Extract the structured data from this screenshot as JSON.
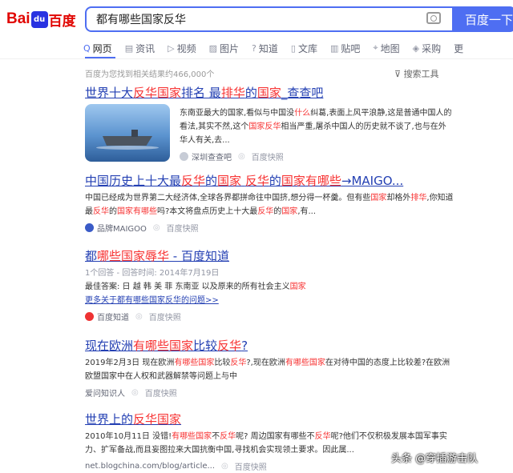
{
  "header": {
    "logo_text": "Bai",
    "logo_du": "du",
    "logo_zh": "百度",
    "search_value": "都有哪些国家反华",
    "search_button": "百度一下"
  },
  "tabs": [
    {
      "label": "网页",
      "icon": "Q"
    },
    {
      "label": "资讯",
      "icon": "▤"
    },
    {
      "label": "视频",
      "icon": "▷"
    },
    {
      "label": "图片",
      "icon": "▨"
    },
    {
      "label": "知道",
      "icon": "?"
    },
    {
      "label": "文库",
      "icon": "▯"
    },
    {
      "label": "贴吧",
      "icon": "▥"
    },
    {
      "label": "地图",
      "icon": "⌖"
    },
    {
      "label": "采购",
      "icon": "◈"
    },
    {
      "label": "更",
      "icon": ""
    }
  ],
  "result_count": "百度为您找到相关结果约466,000个",
  "search_tools": "搜索工具",
  "results": [
    {
      "title": "世界十大<em>反华国家</em>排名 最<em>排华</em>的<em>国家</em>_查查吧",
      "abstract": "东南亚最大的国家,看似与中国没<em>什么</em>纠葛,表面上风平浪静,这是普通中国人的看法,其实不然,这个<em>国家反华</em>相当严重,屠杀中国人的历史就不谈了,也与在外华人有关,去...",
      "source": "深圳查查吧",
      "snapshot": "百度快照"
    },
    {
      "title": "中国历史上十大最<em>反华</em>的<em>国家</em> <em>反华</em>的<em>国家有哪些</em>→MAIGO...",
      "abstract": "中国已经成为世界第二大经济体,全球各界都拼命往中国挤,想分得一杯羹。但有些<em>国家</em>却格外<em>排华</em>,你知道最<em>反华</em>的<em>国家有哪些</em>吗?本文将盘点历史上十大最<em>反华</em>的<em>国家</em>,有...",
      "source": "品牌MAIGOO",
      "snapshot": "百度快照"
    },
    {
      "title": "都<em>哪些国家辱华</em> - 百度知道",
      "meta_line": "1个回答 - 回答时间: 2014年7月19日",
      "best_answer": "最佳答案: 日 越 韩 美 菲 东南亚 以及原来的所有社会主义<em>国家</em>",
      "more_link": "更多关于都有哪些国家反华的问题>>",
      "source": "百度知道",
      "snapshot": "百度快照"
    },
    {
      "title": "现在欧洲<em>有哪些国家</em>比较<em>反华</em>?",
      "abstract": "2019年2月3日 现在欧洲<em>有哪些国家</em>比较<em>反华</em>?,现在欧洲<em>有哪些国家</em>在对待中国的态度上比较差?在欧洲欧盟国家中在人权和武器解禁等问题上与中",
      "source": "爱问知识人",
      "snapshot": "百度快照"
    },
    {
      "title": "世界上的<em>反华国家</em>",
      "abstract": "2010年10月11日 没错!<em>有哪些国家</em>不<em>反华</em>呢? 周边国家有哪些不<em>反华</em>呢?他们不仅积极发展本国军事实力、扩军备战,而且妄图拉来大国抗衡中国,寻找机会实现领土要求。因此属...",
      "source": "net.blogchina.com/blog/article...",
      "snapshot": "百度快照"
    }
  ],
  "watermark": "头条 @穿插游击队"
}
